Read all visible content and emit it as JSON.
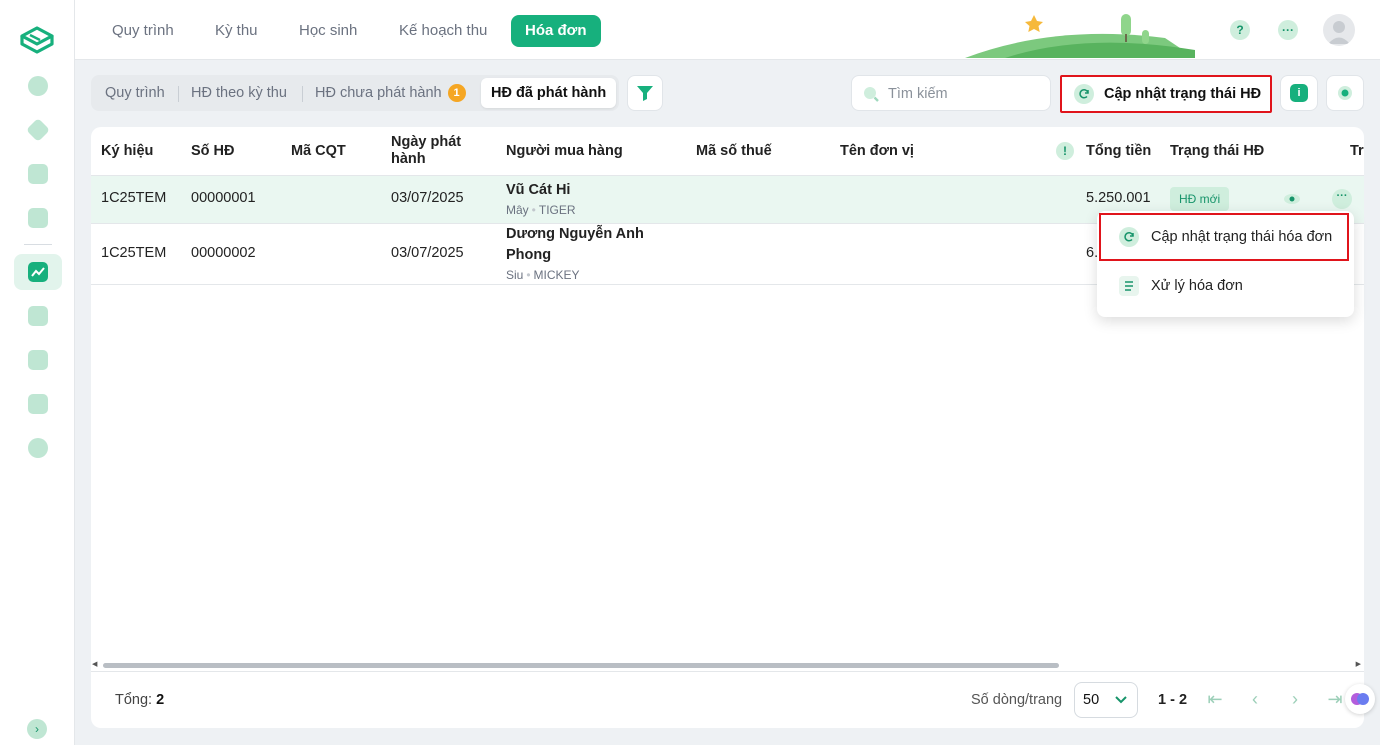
{
  "colors": {
    "accent": "#17b07d",
    "accent_light": "#cfeedd",
    "highlight_border": "#e0141b",
    "badge_orange": "#f5a623"
  },
  "top_tabs": [
    {
      "label": "Quy trình"
    },
    {
      "label": "Kỳ thu"
    },
    {
      "label": "Học sinh"
    },
    {
      "label": "Kế hoạch thu"
    },
    {
      "label": "Hóa đơn",
      "active": true
    }
  ],
  "header_icons": [
    "help-icon",
    "more-icon",
    "user-avatar"
  ],
  "sub_tabs": [
    {
      "label": "Quy trình"
    },
    {
      "label": "HĐ theo kỳ thu"
    },
    {
      "label": "HĐ chưa phát hành",
      "badge": "1"
    },
    {
      "label": "HĐ đã phát hành",
      "active": true
    }
  ],
  "search": {
    "placeholder": "Tìm kiếm"
  },
  "toolbar": {
    "update_status_label": "Cập nhật trạng thái HĐ",
    "info_label": "i"
  },
  "table": {
    "columns": [
      "Ký hiệu",
      "Số HĐ",
      "Mã CQT",
      "Ngày phát hành",
      "Người mua hàng",
      "Mã số thuế",
      "Tên đơn vị",
      "Tổng tiền",
      "Trạng thái HĐ",
      "Tr"
    ],
    "rows": [
      {
        "ky_hieu": "1C25TEM",
        "so_hd": "00000001",
        "ma_cqt": "",
        "ngay": "03/07/2025",
        "buyer_name": "Vũ Cát Hi",
        "buyer_sub1": "Mây",
        "buyer_sub2": "TIGER",
        "mst": "",
        "ten_don_vi": "",
        "tong_tien": "5.250.001",
        "trang_thai": "HĐ mới",
        "selected": true
      },
      {
        "ky_hieu": "1C25TEM",
        "so_hd": "00000002",
        "ma_cqt": "",
        "ngay": "03/07/2025",
        "buyer_name": "Dương Nguyễn Anh Phong",
        "buyer_sub1": "Siu",
        "buyer_sub2": "MICKEY",
        "mst": "",
        "ten_don_vi": "",
        "tong_tien": "6.",
        "trang_thai": ""
      }
    ]
  },
  "footer": {
    "total_label": "Tổng:",
    "total_value": "2",
    "rows_per_page_label": "Số dòng/trang",
    "rows_per_page": "50",
    "range": "1 - 2"
  },
  "context_menu": {
    "items": [
      {
        "label": "Cập nhật trạng thái hóa đơn",
        "icon": "refresh-icon"
      },
      {
        "label": "Xử lý hóa đơn",
        "icon": "document-icon"
      }
    ]
  }
}
